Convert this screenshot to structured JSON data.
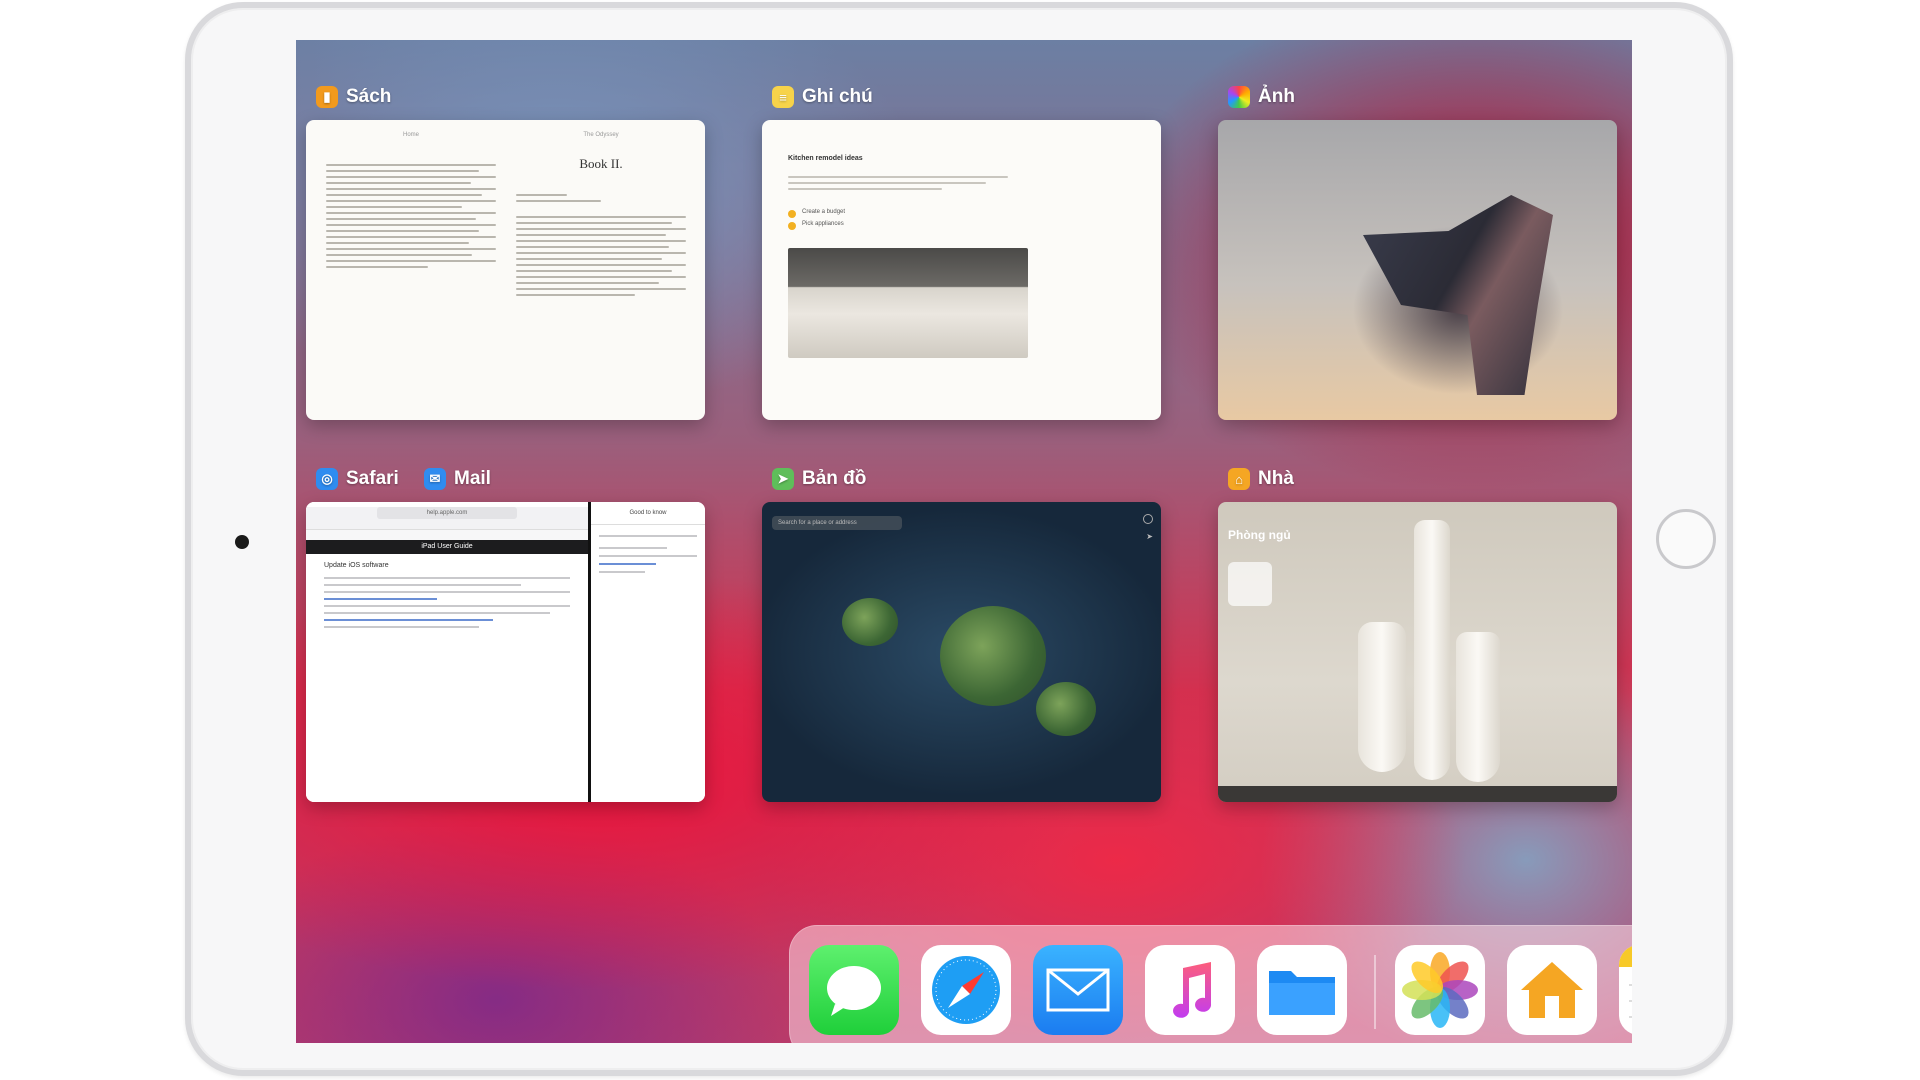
{
  "apps": {
    "books": {
      "label": "Sách",
      "page_title": "Book II.",
      "page_header_left": "Home",
      "page_header_right": "The Odyssey",
      "subtitle": "BOOK II."
    },
    "notes": {
      "label": "Ghi chú",
      "note_title": "Kitchen remodel ideas",
      "item1": "Create a budget",
      "item2": "Pick appliances"
    },
    "photos": {
      "label": "Ảnh"
    },
    "safari": {
      "label": "Safari",
      "url": "help.apple.com",
      "page_header": "iPad User Guide",
      "heading": "Update iOS software"
    },
    "mail": {
      "label": "Mail",
      "header": "Good to know"
    },
    "maps": {
      "label": "Bản đồ",
      "search_placeholder": "Search for a place or address"
    },
    "home": {
      "label": "Nhà",
      "room": "Phòng ngủ"
    }
  },
  "dock": {
    "items": [
      "messages-icon",
      "safari-icon",
      "mail-icon",
      "music-icon",
      "files-icon",
      "photos-icon",
      "home-icon",
      "notes-icon"
    ]
  },
  "colors": {
    "books_icon": "#f29a1d",
    "notes_icon": "#f7d34a",
    "safari_icon": "#2f8cf0",
    "mail_icon": "#2f8cf0",
    "maps_icon": "#5fbe5a",
    "home_icon": "#f5a623"
  }
}
